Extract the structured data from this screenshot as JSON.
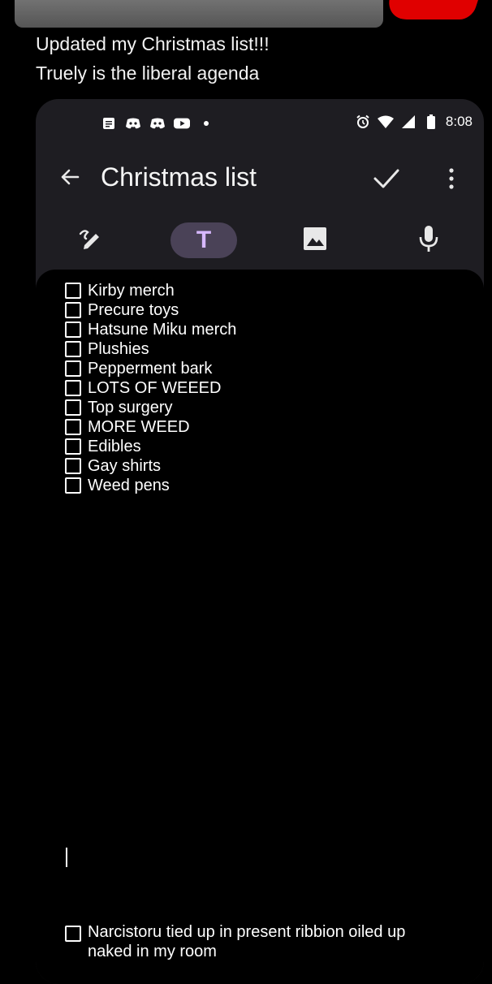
{
  "post": {
    "line1": "Updated my Christmas list!!!",
    "line2": "Truely is the liberal agenda"
  },
  "status_bar": {
    "time": "8:08",
    "left_icons": [
      "notes-icon",
      "discord-icon",
      "discord-icon",
      "youtube-icon",
      "dot-icon"
    ],
    "right_icons": [
      "alarm-icon",
      "wifi-icon",
      "signal-icon",
      "battery-icon"
    ]
  },
  "app_bar": {
    "title": "Christmas list"
  },
  "toolbar": {
    "text_mode_glyph": "T",
    "active_color": "#d7b8ff",
    "active_bg": "#4a4257"
  },
  "checklist": [
    "Kirby merch",
    "Precure toys",
    "Hatsune Miku merch",
    "Plushies",
    "Pepperment bark",
    "LOTS OF WEEED",
    "Top surgery",
    "MORE WEED",
    "Edibles",
    "Gay shirts",
    "Weed pens"
  ],
  "last_item": "Narcistoru tied up in present ribbion oiled up naked in my room"
}
